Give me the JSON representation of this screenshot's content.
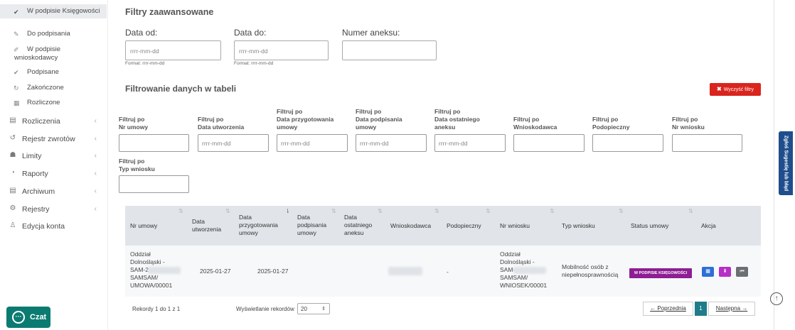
{
  "sidebar": {
    "sub_items": [
      {
        "icon": "check-circle-icon",
        "glyph": "✔",
        "label": "W podpisie Księgowości",
        "active": true
      },
      {
        "icon": "edit-icon",
        "glyph": "✎",
        "label": "Do podpisania",
        "active": false
      },
      {
        "icon": "pen-icon",
        "glyph": "✐",
        "label_line1": "W podpisie",
        "label_line2": "wnioskodawcy",
        "active": false
      },
      {
        "icon": "check-circle-icon",
        "glyph": "✔",
        "label": "Podpisane",
        "active": false
      },
      {
        "icon": "rotate-icon",
        "glyph": "↻",
        "label": "Zakończone",
        "active": false
      },
      {
        "icon": "calculator-icon",
        "glyph": "▦",
        "label": "Rozliczone",
        "active": false
      }
    ],
    "nav_items": [
      {
        "icon": "table-icon",
        "glyph": "▤",
        "label": "Rozliczenia"
      },
      {
        "icon": "undo-icon",
        "glyph": "↺",
        "label": "Rejestr zwrotów"
      },
      {
        "icon": "users-icon",
        "glyph": "☗",
        "label": "Limity"
      },
      {
        "icon": "pie-chart-icon",
        "glyph": "◔",
        "label": "Raporty"
      },
      {
        "icon": "archive-icon",
        "glyph": "▤",
        "label": "Archiwum"
      },
      {
        "icon": "gears-icon",
        "glyph": "⚙",
        "label": "Rejestry"
      },
      {
        "icon": "user-icon",
        "glyph": "♙",
        "label": "Edycja konta"
      }
    ],
    "chat_label": "Czat"
  },
  "advanced_filters": {
    "title": "Filtry zaawansowane",
    "date_from": {
      "label": "Data od:",
      "placeholder": "rrrr-mm-dd",
      "hint": "Format: rrrr-mm-dd"
    },
    "date_to": {
      "label": "Data do:",
      "placeholder": "rrrr-mm-dd",
      "hint": "Format: rrrr-mm-dd"
    },
    "annex_number": {
      "label": "Numer aneksu:",
      "placeholder": ""
    }
  },
  "table_filters": {
    "title": "Filtrowanie danych w tabeli",
    "clear_button": "Wyczyść filtry",
    "fields": [
      {
        "line1": "Filtruj po",
        "line2": "Nr umowy",
        "placeholder": ""
      },
      {
        "line1": "Filtruj po",
        "line2": "Data utworzenia",
        "placeholder": "rrrr-mm-dd"
      },
      {
        "line1": "Filtruj po",
        "line2": "Data przygotowania",
        "line3": "umowy",
        "placeholder": "rrrr-mm-dd"
      },
      {
        "line1": "Filtruj po",
        "line2": "Data podpisania",
        "line3": "umowy",
        "placeholder": "rrrr-mm-dd"
      },
      {
        "line1": "Filtruj po",
        "line2": "Data ostatniego",
        "line3": "aneksu",
        "placeholder": "rrrr-mm-dd"
      },
      {
        "line1": "Filtruj po",
        "line2": "Wnioskodawca",
        "placeholder": ""
      },
      {
        "line1": "Filtruj po",
        "line2": "Podopieczny",
        "placeholder": ""
      },
      {
        "line1": "Filtruj po",
        "line2": "Nr wniosku",
        "placeholder": ""
      },
      {
        "line1": "Filtruj po",
        "line2": "Typ wniosku",
        "placeholder": ""
      }
    ]
  },
  "table": {
    "headers": [
      {
        "l1": "Nr umowy"
      },
      {
        "l1": "Data",
        "l2": "utworzenia"
      },
      {
        "l1": "Data",
        "l2": "przygotowania",
        "l3": "umowy"
      },
      {
        "l1": "Data",
        "l2": "podpisania",
        "l3": "umowy"
      },
      {
        "l1": "Data",
        "l2": "ostatniego",
        "l3": "aneksu"
      },
      {
        "l1": "Wnioskodawca"
      },
      {
        "l1": "Podopieczny"
      },
      {
        "l1": "Nr wniosku"
      },
      {
        "l1": "Typ wniosku"
      },
      {
        "l1": "Status umowy"
      },
      {
        "l1": "Akcja"
      }
    ],
    "sort_icon": "⇅",
    "row": {
      "nr_umowy": [
        "Oddział",
        "Dolnośląski -",
        "SAM-2",
        "SAMSAM/",
        "UMOWA/00001"
      ],
      "data_utworzenia": "2025-01-27",
      "data_przygotowania": "2025-01-27",
      "data_podpisania": "",
      "data_aneksu": "",
      "wnioskodawca": "",
      "podopieczny": "-",
      "nr_wniosku": [
        "Oddział",
        "Dolnośląski -",
        "SAM-",
        "SAMSAM/",
        "WNIOSEK/00001"
      ],
      "typ_wniosku": [
        "Mobilność osób z",
        "niepełnosprawnością"
      ],
      "status": "W PODPISIE KSIĘGOWOŚCI",
      "actions": [
        {
          "icon": "calendar-icon",
          "glyph": "▦",
          "color": "#2e6fd6"
        },
        {
          "icon": "download-icon",
          "glyph": "⬇",
          "color": "#b62fc7"
        },
        {
          "icon": "history-icon",
          "glyph": "⏮",
          "color": "#6b6f73"
        }
      ]
    }
  },
  "footer": {
    "records_info": "Rekordy 1 do 1 z 1",
    "show_label": "Wyświetlanie rekordów",
    "page_size": "20",
    "prev": "← Poprzednia",
    "page": "1",
    "next": "Następna →"
  },
  "side_tab": "Zgłoś Sugestię lub błąd",
  "scroll_top_glyph": "↑",
  "colors": {
    "primary": "#1f7c8a",
    "danger": "#d9251d",
    "status": "#8e1e93",
    "chat": "#0b7b72",
    "side_tab": "#1e4e8c"
  }
}
